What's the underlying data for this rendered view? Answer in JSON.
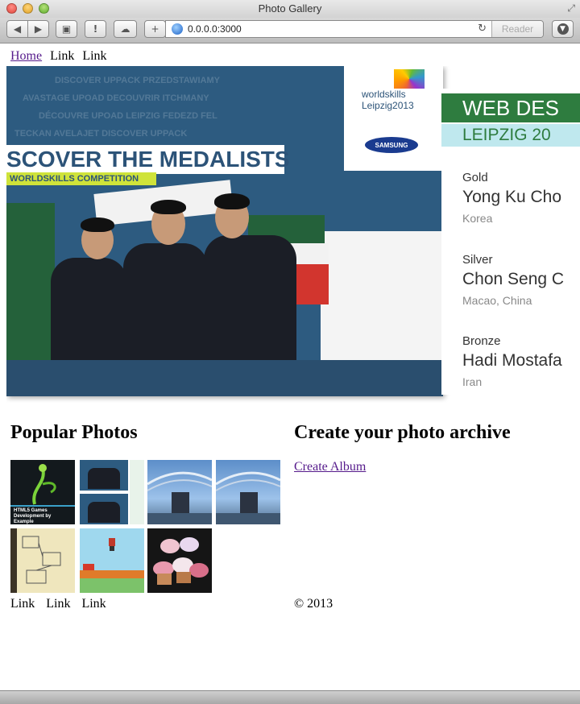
{
  "window": {
    "title": "Photo Gallery"
  },
  "toolbar": {
    "url": "0.0.0.0:3000",
    "reader_label": "Reader"
  },
  "nav": {
    "items": [
      "Home",
      "Link",
      "Link"
    ]
  },
  "hero": {
    "poster_banner": "SCOVER THE MEDALISTS",
    "poster_subbanner": "WORLDSKILLS COMPETITION",
    "poster_logo_line1": "worldskills",
    "poster_logo_line2": "Leipzig2013",
    "poster_sponsor": "SAMSUNG",
    "results_title": "WEB DES",
    "results_city": "LEIPZIG 20",
    "medals": [
      {
        "label": "Gold",
        "name": "Yong Ku Cho",
        "country": "Korea"
      },
      {
        "label": "Silver",
        "name": "Chon Seng C",
        "country": "Macao, China"
      },
      {
        "label": "Bronze",
        "name": "Hadi Mostafa",
        "country": "Iran"
      }
    ]
  },
  "popular": {
    "heading": "Popular Photos",
    "thumb1_caption": "HTML5 Games Development by Example"
  },
  "create": {
    "heading": "Create your photo archive",
    "link": "Create Album"
  },
  "footer": {
    "links": [
      "Link",
      "Link",
      "Link"
    ],
    "copyright": "© 2013"
  },
  "colors": {
    "visited_link": "#551a8b",
    "results_bar": "#2e7c3f",
    "results_city_bg": "#bfe8ee"
  }
}
